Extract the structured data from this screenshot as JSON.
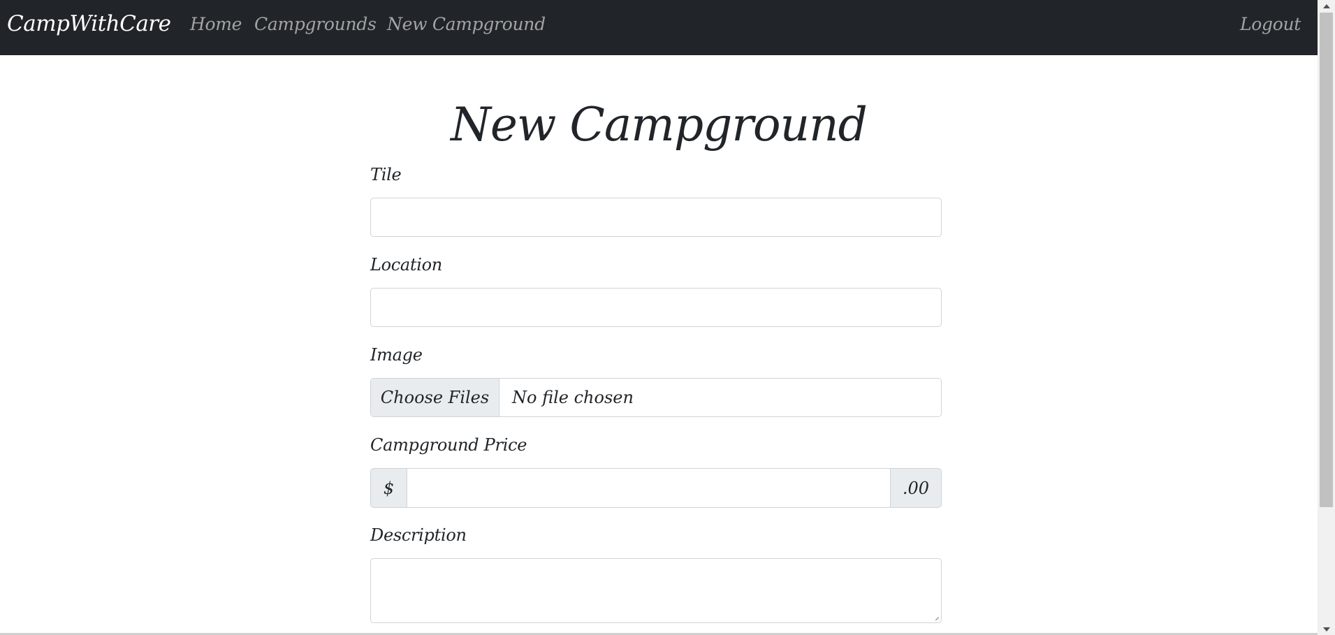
{
  "navbar": {
    "brand": "CampWithCare",
    "links": {
      "home": "Home",
      "campgrounds": "Campgrounds",
      "new_campground": "New Campground",
      "logout": "Logout"
    }
  },
  "form": {
    "heading": "New Campground",
    "title_label": "Tile",
    "title_value": "",
    "location_label": "Location",
    "location_value": "",
    "image_label": "Image",
    "image_button": "Choose Files",
    "image_status": "No file chosen",
    "price_label": "Campground Price",
    "price_prefix": "$",
    "price_value": "",
    "price_suffix": ".00",
    "description_label": "Description",
    "description_value": ""
  },
  "colors": {
    "navbar_bg": "#212529",
    "addon_bg": "#e9ecef",
    "border": "#ced4da"
  }
}
